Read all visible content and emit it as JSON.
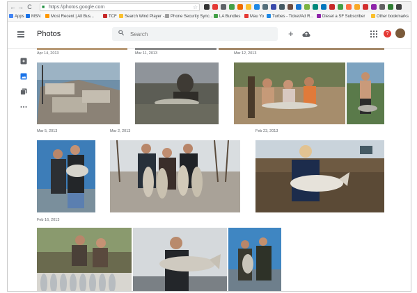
{
  "browser": {
    "url": "https://photos.google.com",
    "nav_back": "←",
    "nav_forward": "→",
    "nav_reload": "C",
    "bookmarks": [
      {
        "label": "Apps",
        "color": "#4285f4"
      },
      {
        "label": "MSN",
        "color": "#1a73e8"
      },
      {
        "label": "Most Recent | All Bus...",
        "color": "#ff9800"
      },
      {
        "label": "TCF",
        "color": "#c62828"
      },
      {
        "label": "Search Wind Player -...",
        "color": "#fbc02d"
      },
      {
        "label": "Phone Security Sync...",
        "color": "#9e9e9e"
      },
      {
        "label": "LA Bundles",
        "color": "#43a047"
      },
      {
        "label": "Mau Yo",
        "color": "#e53935"
      },
      {
        "label": "Turbes - Ticket/Ad R...",
        "color": "#1e88e5"
      },
      {
        "label": "Diesel a SF Subscriber",
        "color": "#8e24aa"
      },
      {
        "label": "Other bookmarks",
        "color": "#fbc02d"
      }
    ]
  },
  "header": {
    "title": "Photos",
    "search_placeholder": "Search",
    "add_label": "+",
    "notification_count": "?"
  },
  "dates": [
    "Apr 14, 2013",
    "Mar 11, 2013",
    "Mar 12, 2013",
    "Mar 5, 2013",
    "Mar 2, 2013",
    "Feb 23, 2013",
    "Feb 16, 2013"
  ],
  "icons": {
    "menu": "hamburger-icon",
    "search": "search-icon",
    "upload": "cloud-upload-icon",
    "apps": "apps-grid-icon",
    "rail": [
      "assistant-icon",
      "photos-icon",
      "albums-icon",
      "more-icon"
    ]
  }
}
